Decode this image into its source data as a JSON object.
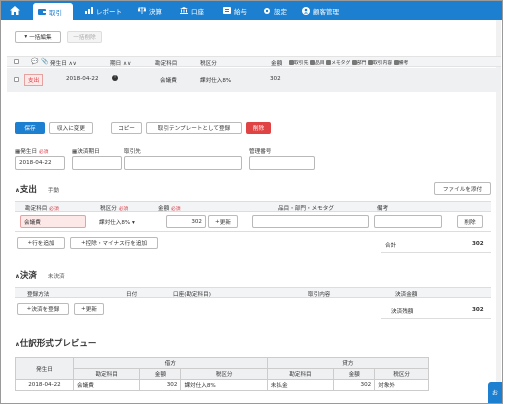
{
  "nav": {
    "tabs": [
      "取引",
      "レポート",
      "決算",
      "口座",
      "給与",
      "設定",
      "顧客管理"
    ]
  },
  "toolbar": {
    "bulk_edit": "一括編集",
    "bulk_delete": "一括削除"
  },
  "list": {
    "columns": {
      "date": "発生日",
      "due": "期日",
      "account": "勘定科目",
      "tax": "税区分",
      "amount": "金額"
    },
    "filters": [
      "取引先",
      "品目",
      "メモタグ",
      "部門",
      "取引内容",
      "備考"
    ],
    "row": {
      "badge": "支出",
      "date": "2018-04-22",
      "account": "会議費",
      "tax": "課対仕入8%",
      "amount": "302"
    }
  },
  "actions": {
    "save": "保存",
    "to_income": "収入に変更",
    "copy": "コピー",
    "template": "取引テンプレートとして登録",
    "delete": "削除"
  },
  "form": {
    "date_label": "発生日",
    "date_value": "2018-04-22",
    "required": "必須",
    "settle_date_label": "決済期日",
    "partner_label": "取引先",
    "mgmt_label": "管理番号"
  },
  "expense": {
    "title": "支出",
    "mode": "手動",
    "attach": "ファイルを添付",
    "headers": {
      "account": "勘定科目",
      "tax": "税区分",
      "amount": "金額",
      "item": "品目・部門・メモタグ",
      "note": "備考"
    },
    "row": {
      "account": "会議費",
      "tax": "課対仕入8%",
      "amount": "302",
      "update": "更新",
      "delete": "削除"
    },
    "add_row": "行を追加",
    "add_deduct": "控除・マイナス行を追加",
    "total_label": "合計",
    "total_value": "302"
  },
  "settlement": {
    "title": "決済",
    "status": "未決済",
    "headers": {
      "method": "登録方法",
      "date": "日付",
      "account": "口座(勘定科目)",
      "content": "取引内容",
      "amount": "決済金額"
    },
    "register": "決済を登録",
    "update": "更新",
    "balance_label": "決済残額",
    "balance_value": "302"
  },
  "preview": {
    "title": "仕訳形式プレビュー",
    "date_head": "発生日",
    "debit": "借方",
    "credit": "貸方",
    "sub": {
      "account": "勘定科目",
      "amount": "金額",
      "tax": "税区分"
    },
    "row": {
      "date": "2018-04-22",
      "d_account": "会議費",
      "d_amount": "302",
      "d_tax": "課対仕入8%",
      "c_account": "未払金",
      "c_amount": "302",
      "c_tax": "対象外"
    }
  },
  "colors": {
    "brand": "#1d7fd0",
    "danger": "#e04343"
  }
}
